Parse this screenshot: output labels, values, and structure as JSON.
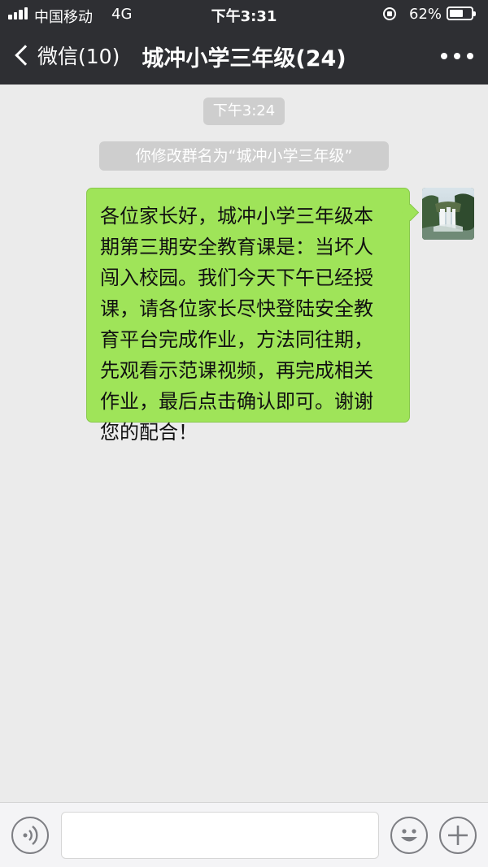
{
  "status_bar": {
    "carrier": "中国移动",
    "network": "4G",
    "time": "下午3:31",
    "battery_percent": "62%",
    "battery_level": 0.62
  },
  "nav": {
    "back_label": "微信(10)",
    "title": "城冲小学三年级(24)"
  },
  "chat": {
    "timestamp": "下午3:24",
    "system_message": "你修改群名为“城冲小学三年级”",
    "message_lines": [
      "各位家长好，城冲小学三年级本",
      "期第三期安全教育课是：当坏人",
      "闯入校园。我们今天下午已经授",
      "课，请各位家长尽快登陆安全教",
      "育平台完成作业，方法同往期，",
      "先观看示范课视频，再完成相关",
      "作业，最后点击确认即可。谢谢",
      "您的配合！"
    ]
  },
  "input_bar": {
    "text_value": "",
    "placeholder": ""
  },
  "icons": {
    "signal": "signal-bars-icon",
    "rotation_lock": "rotation-lock-icon",
    "battery": "battery-icon",
    "back": "chevron-left-icon",
    "more": "more-dots-icon",
    "voice": "voice-icon",
    "emoji": "emoji-icon",
    "plus": "plus-icon"
  },
  "colors": {
    "topbar_bg": "#2e2f33",
    "chat_bg": "#ebebeb",
    "bubble_green": "#9fe459",
    "pill_gray": "#cecece"
  }
}
